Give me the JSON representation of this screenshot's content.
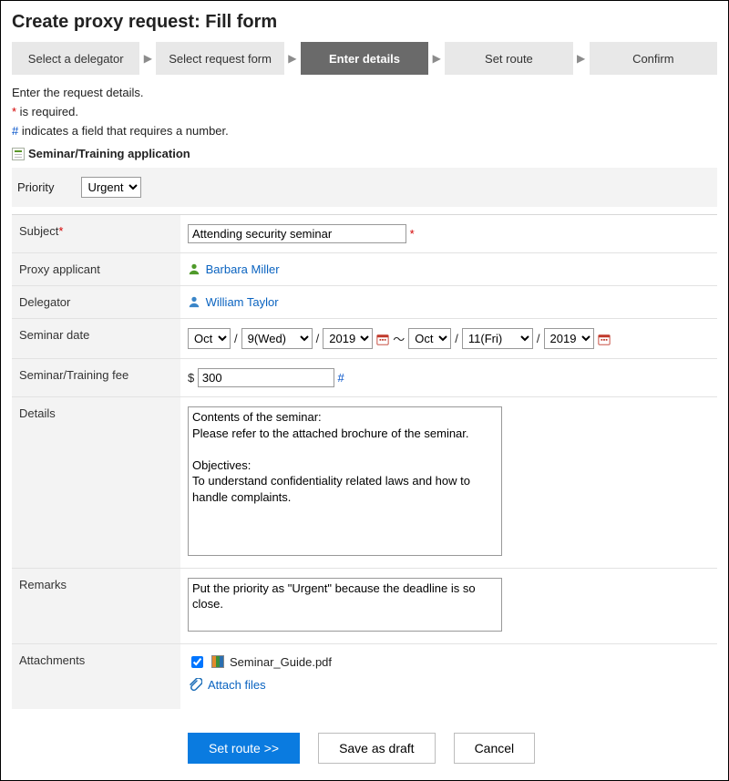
{
  "page_title": "Create proxy request: Fill form",
  "steps": [
    "Select a delegator",
    "Select request form",
    "Enter details",
    "Set route",
    "Confirm"
  ],
  "active_step_index": 2,
  "instructions": {
    "line1": "Enter the request details.",
    "required_note": " is required.",
    "number_note": " indicates a field that requires a number."
  },
  "form_type": "Seminar/Training application",
  "priority": {
    "label": "Priority",
    "value": "Urgent"
  },
  "fields": {
    "subject": {
      "label": "Subject",
      "value": "Attending security seminar"
    },
    "proxy_applicant": {
      "label": "Proxy applicant",
      "name": "Barbara Miller"
    },
    "delegator": {
      "label": "Delegator",
      "name": "William Taylor"
    },
    "seminar_date": {
      "label": "Seminar date",
      "start": {
        "month": "Oct",
        "day": "9(Wed)",
        "year": "2019"
      },
      "end": {
        "month": "Oct",
        "day": "11(Fri)",
        "year": "2019"
      },
      "separator": "～",
      "slash": "/"
    },
    "fee": {
      "label": "Seminar/Training fee",
      "currency": "$",
      "value": "300"
    },
    "details": {
      "label": "Details",
      "value": "Contents of the seminar:\nPlease refer to the attached brochure of the seminar.\n\nObjectives:\nTo understand confidentiality related laws and how to handle complaints."
    },
    "remarks": {
      "label": "Remarks",
      "value": "Put the priority as \"Urgent\" because the deadline is so close."
    },
    "attachments": {
      "label": "Attachments",
      "files": [
        "Seminar_Guide.pdf"
      ],
      "attach_link": "Attach files"
    }
  },
  "buttons": {
    "primary": "Set route >>",
    "save_draft": "Save as draft",
    "cancel": "Cancel"
  }
}
